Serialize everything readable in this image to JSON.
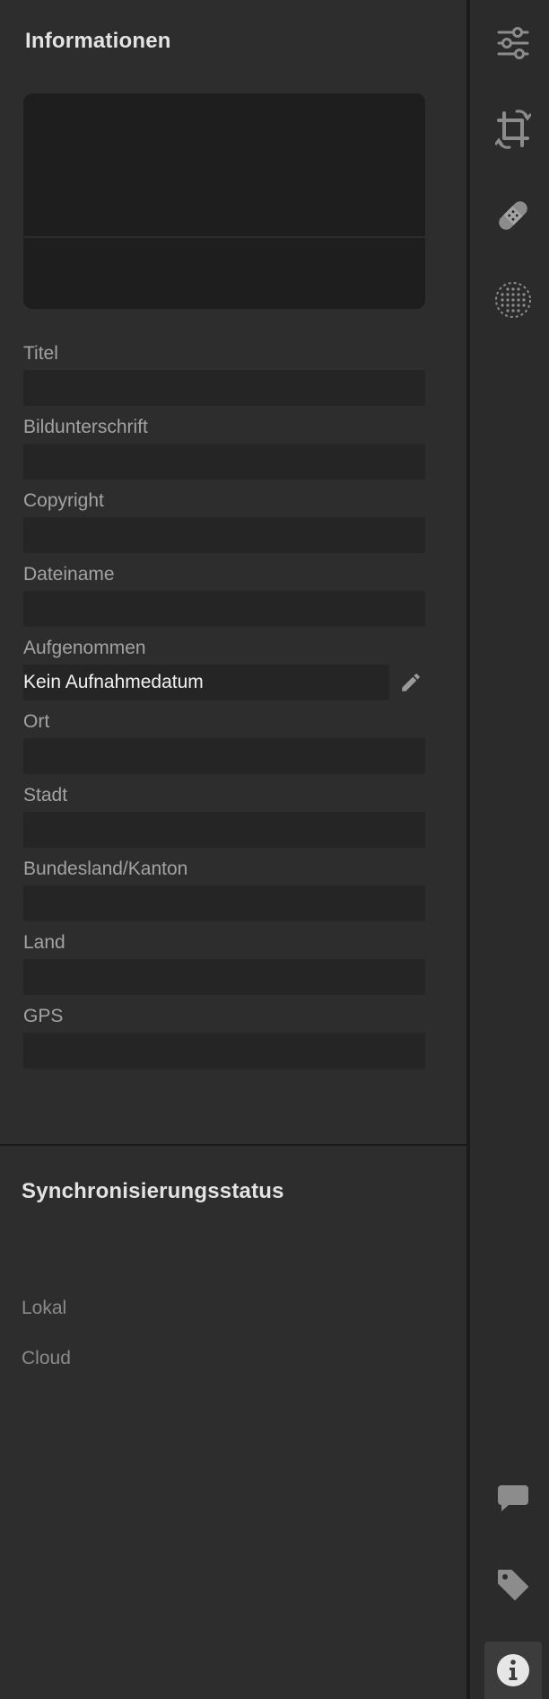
{
  "info": {
    "title": "Informationen",
    "fields": [
      {
        "label": "Titel",
        "value": ""
      },
      {
        "label": "Bildunterschrift",
        "value": ""
      },
      {
        "label": "Copyright",
        "value": ""
      },
      {
        "label": "Dateiname",
        "value": ""
      }
    ],
    "captured": {
      "label": "Aufgenommen",
      "value": "Kein Aufnahmedatum"
    },
    "location_fields": [
      {
        "label": "Ort",
        "value": ""
      },
      {
        "label": "Stadt",
        "value": ""
      },
      {
        "label": "Bundesland/Kanton",
        "value": ""
      },
      {
        "label": "Land",
        "value": ""
      },
      {
        "label": "GPS",
        "value": ""
      }
    ]
  },
  "sync": {
    "title": "Synchronisierungsstatus",
    "local_label": "Lokal",
    "cloud_label": "Cloud"
  },
  "rail": {
    "top_icons": [
      "sliders-icon",
      "crop-icon",
      "healing-bandage-icon",
      "mask-dots-icon"
    ],
    "bottom_icons": [
      "comment-icon",
      "tag-icon",
      "info-icon"
    ],
    "active": "info-icon"
  },
  "colors": {
    "panel_bg": "#2d2d2d",
    "field_bg": "#252525",
    "icon_gray": "#8c8c8c",
    "icon_active": "#e6e6e6"
  }
}
